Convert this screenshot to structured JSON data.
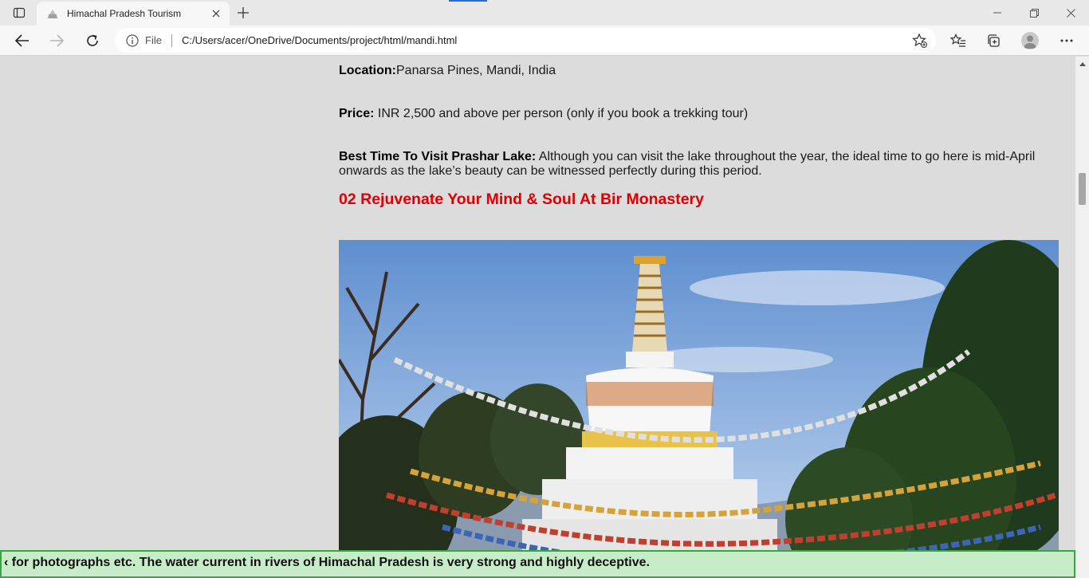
{
  "browser": {
    "tab_title": "Himachal Pradesh Tourism",
    "address_scheme_label": "File",
    "url": "C:/Users/acer/OneDrive/Documents/project/html/mandi.html"
  },
  "page": {
    "location_label": "Location:",
    "location_value": "Panarsa Pines, Mandi, India",
    "price_label": "Price:",
    "price_value": " INR 2,500 and above per person (only if you book a trekking tour)",
    "best_time_label": "Best Time To Visit Prashar Lake:",
    "best_time_value": " Although you can visit the lake throughout the year, the ideal time to go here is mid-April onwards as the lake’s beauty can be witnessed perfectly during this period.",
    "section_heading": "02 Rejuvenate Your Mind & Soul At Bir Monastery",
    "photo_subject": "white Buddhist stupa with prayer flags"
  },
  "marquee": {
    "text": "‹ for photographs etc. The water current in rivers of Himachal Pradesh is very strong and highly deceptive."
  },
  "colors": {
    "heading": "#e00000",
    "marquee_bg": "#c6ecc8",
    "marquee_border": "#3aa63f",
    "page_bg": "#dcdcdc"
  },
  "icons": [
    "sidebar-toggle-icon",
    "tab-favicon",
    "close-icon",
    "plus-icon",
    "minimize-icon",
    "restore-icon",
    "back-icon",
    "forward-icon",
    "refresh-icon",
    "info-icon",
    "add-favorite-icon",
    "favorites-icon",
    "collections-icon",
    "profile-icon",
    "more-icon"
  ]
}
